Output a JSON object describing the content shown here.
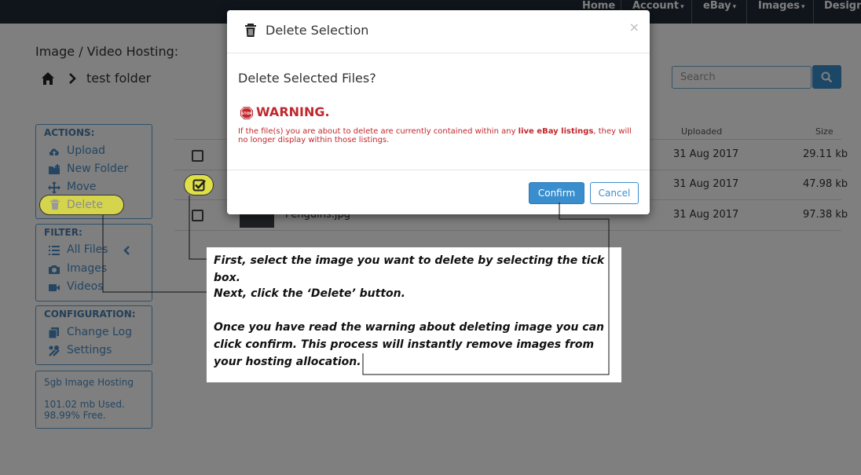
{
  "navbar": {
    "items": [
      {
        "label": "Home",
        "dropdown": false
      },
      {
        "label": "Account",
        "dropdown": true
      },
      {
        "label": "eBay",
        "dropdown": true
      },
      {
        "label": "Images",
        "dropdown": true
      },
      {
        "label": "Design I",
        "dropdown": false
      }
    ],
    "caret": "▾"
  },
  "page": {
    "title": "Image / Video Hosting:",
    "breadcrumb_folder": "test folder"
  },
  "search": {
    "placeholder": "Search"
  },
  "sidebar": {
    "actions": {
      "heading": "ACTIONS:",
      "items": [
        {
          "label": "Upload",
          "icon": "cloud-upload-icon"
        },
        {
          "label": "New Folder",
          "icon": "folder-plus-icon"
        },
        {
          "label": "Move",
          "icon": "move-arrows-icon"
        },
        {
          "label": "Delete",
          "icon": "trash-icon"
        }
      ]
    },
    "filter": {
      "heading": "FILTER:",
      "items": [
        {
          "label": "All Files",
          "icon": "list-icon"
        },
        {
          "label": "Images",
          "icon": "camera-icon"
        },
        {
          "label": "Videos",
          "icon": "video-camera-icon"
        }
      ]
    },
    "configuration": {
      "heading": "CONFIGURATION:",
      "items": [
        {
          "label": "Change Log",
          "icon": "copy-icon"
        },
        {
          "label": "Settings",
          "icon": "wrench-icon"
        }
      ]
    },
    "hosting": {
      "plan": "5gb Image Hosting",
      "used": "101.02 mb Used.",
      "free": "98.99% Free."
    }
  },
  "table": {
    "columns": {
      "uploaded": "Uploaded",
      "size": "Size"
    },
    "rows": [
      {
        "name": "",
        "uploaded": "31 Aug 2017",
        "size": "29.11 kb",
        "checked": false
      },
      {
        "name": "",
        "uploaded": "31 Aug 2017",
        "size": "47.98 kb",
        "checked": true
      },
      {
        "name": "Penguins.jpg",
        "uploaded": "31 Aug 2017",
        "size": "97.38 kb",
        "checked": false
      }
    ]
  },
  "modal": {
    "title": "Delete Selection",
    "close": "×",
    "question": "Delete Selected Files?",
    "warning_title": "WARNING.",
    "warning_text_before": "If the file(s) you are about to delete are currently contained within any ",
    "warning_text_bold": "live eBay listings",
    "warning_text_after": ", they will no longer display within those listings.",
    "confirm": "Confirm",
    "cancel": "Cancel",
    "stop_icon_text": "STOP"
  },
  "annotations": {
    "step1": "First, select the image you want to delete by selecting the tick box.",
    "step2": "Next, click the ‘Delete’ button.",
    "step3": "Once you have read the warning about deleting image you can click confirm. This process will instantly remove images from your hosting allocation.",
    "highlight_color": "#f0f03c"
  },
  "colors": {
    "navbar": "#1f2a36",
    "accent": "#3a8ecd",
    "warning": "#c0282d",
    "sidebar_text": "#4a8cc4"
  }
}
